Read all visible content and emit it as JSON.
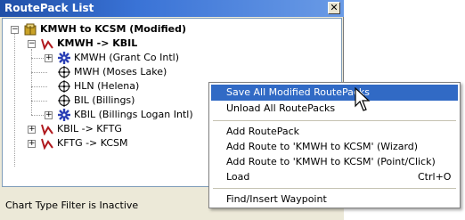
{
  "window": {
    "title": "RoutePack List",
    "close_glyph": "✕"
  },
  "tree": {
    "root": {
      "label": "KMWH to KCSM (Modified)",
      "icon": "routepack-icon"
    },
    "route1": {
      "label": "KMWH -> KBIL",
      "icon": "route-icon"
    },
    "waypoints": [
      {
        "label": "KMWH (Grant Co Intl)",
        "icon": "airport-icon"
      },
      {
        "label": "MWH (Moses Lake)",
        "icon": "vor-icon"
      },
      {
        "label": "HLN (Helena)",
        "icon": "vor-icon"
      },
      {
        "label": "BIL (Billings)",
        "icon": "vor-icon"
      },
      {
        "label": "KBIL (Billings Logan Intl)",
        "icon": "airport-icon"
      }
    ],
    "route2": {
      "label": "KBIL -> KFTG",
      "icon": "route-icon"
    },
    "route3": {
      "label": "KFTG -> KCSM",
      "icon": "route-icon"
    }
  },
  "status": {
    "text": "Chart Type Filter is Inactive"
  },
  "context_menu": {
    "items": [
      {
        "label": "Save All Modified RoutePacks",
        "shortcut": ""
      },
      {
        "label": "Unload All RoutePacks",
        "shortcut": ""
      },
      {
        "label": "Add RoutePack",
        "shortcut": ""
      },
      {
        "label": "Add Route to 'KMWH to KCSM' (Wizard)",
        "shortcut": ""
      },
      {
        "label": "Add Route to 'KMWH to KCSM' (Point/Click)",
        "shortcut": ""
      },
      {
        "label": "Load",
        "shortcut": "Ctrl+O"
      },
      {
        "label": "Find/Insert Waypoint",
        "shortcut": ""
      }
    ]
  },
  "colors": {
    "title_bar": "#3a73d6",
    "menu_highlight": "#316ac5",
    "route_icon": "#b0191e",
    "airport_icon": "#2a3fb5"
  }
}
